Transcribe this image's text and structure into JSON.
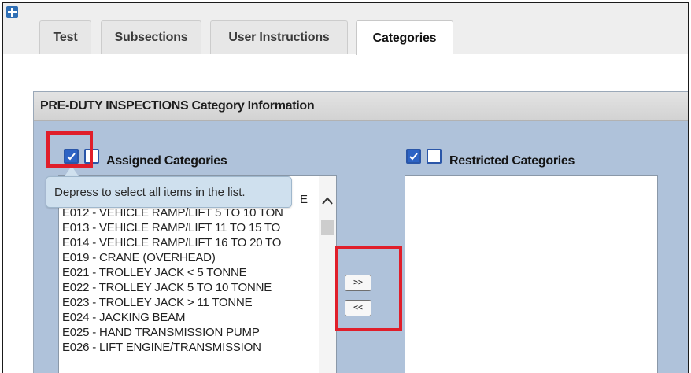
{
  "tabs": [
    {
      "label": "Test"
    },
    {
      "label": "Subsections"
    },
    {
      "label": "User Instructions"
    },
    {
      "label": "Categories"
    }
  ],
  "panel": {
    "title": "PRE-DUTY INSPECTIONS Category Information"
  },
  "assigned": {
    "title": "Assigned Categories",
    "items": [
      "E",
      "E012 - VEHICLE RAMP/LIFT  5 TO 10 TON",
      "E013 - VEHICLE RAMP/LIFT  11 TO 15 TO",
      "E014 - VEHICLE RAMP/LIFT  16 TO 20 TO",
      "E019 - CRANE (OVERHEAD)",
      "E021 - TROLLEY JACK < 5 TONNE",
      "E022 - TROLLEY JACK 5 TO 10 TONNE",
      "E023 - TROLLEY JACK > 11 TONNE",
      "E024 - JACKING BEAM",
      "E025 - HAND TRANSMISSION PUMP",
      "E026 - LIFT ENGINE/TRANSMISSION"
    ]
  },
  "restricted": {
    "title": "Restricted Categories"
  },
  "buttons": {
    "move_right": ">>",
    "move_left": "<<"
  },
  "tooltip": {
    "text": "Depress to select all items in the list."
  },
  "colors": {
    "panel_bg": "#afc2da",
    "checkbox_blue": "#2d63c4",
    "highlight_red": "#e01e2a"
  }
}
